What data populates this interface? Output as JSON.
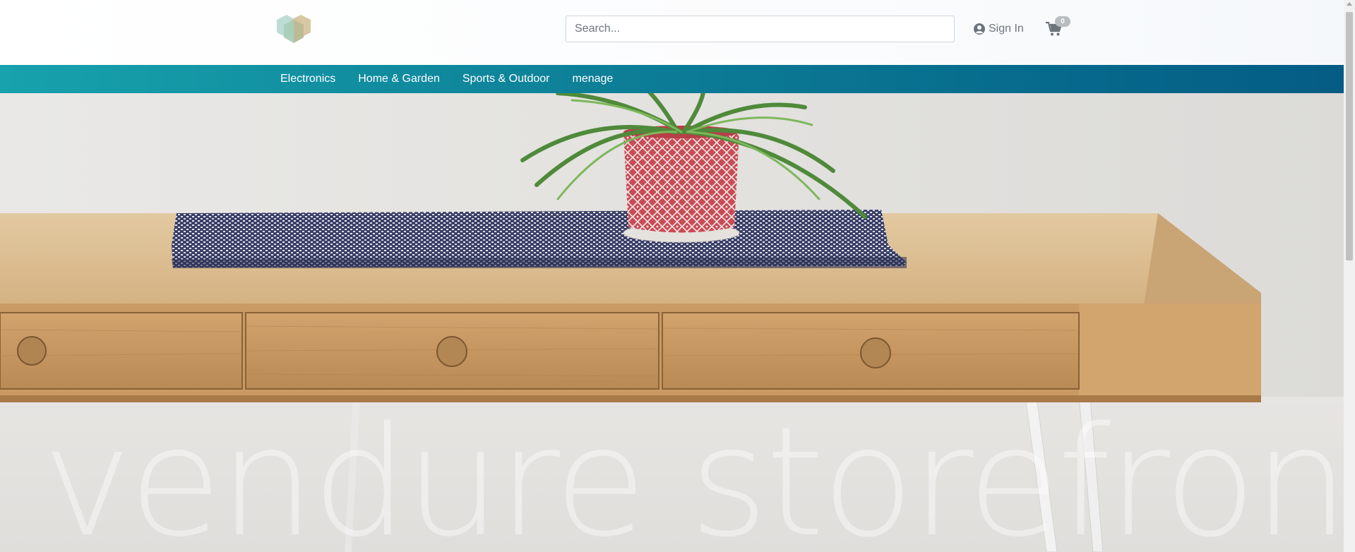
{
  "header": {
    "logo_icon": "vendure-logo-icon",
    "search": {
      "placeholder": "Search...",
      "value": ""
    },
    "sign_in_label": "Sign In",
    "user_icon": "user-circle-icon",
    "cart_icon": "shopping-cart-icon",
    "cart_count": "0"
  },
  "nav": {
    "items": [
      {
        "label": "Electronics"
      },
      {
        "label": "Home & Garden"
      },
      {
        "label": "Sports & Outdoor"
      },
      {
        "label": "menage"
      }
    ]
  },
  "hero": {
    "title": "vendure storefront"
  },
  "colors": {
    "nav_gradient_start": "#17a2ad",
    "nav_gradient_end": "#055c84",
    "badge": "#b7bcc1",
    "text_muted": "#6c757d"
  }
}
